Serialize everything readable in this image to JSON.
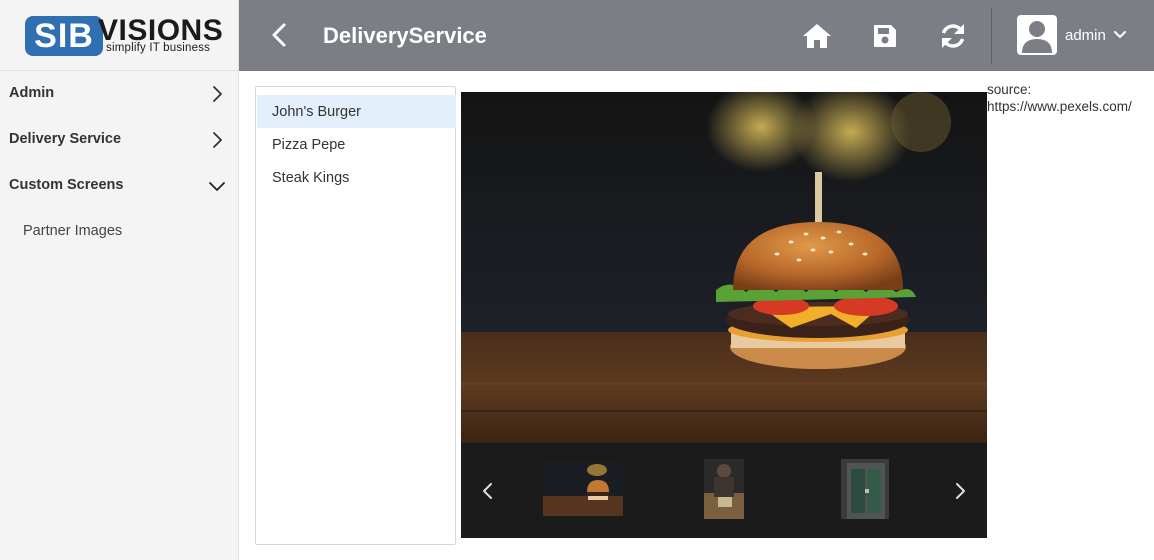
{
  "brand": {
    "logo_left": "SIB",
    "logo_right": "VISIONS",
    "tagline": "simplify IT business"
  },
  "header": {
    "title": "DeliveryService",
    "icons": [
      "back-icon",
      "home-icon",
      "save-icon",
      "refresh-icon",
      "chevron-down-icon"
    ],
    "user_name": "admin"
  },
  "sidebar": {
    "items": [
      {
        "label": "Admin",
        "expanded": false
      },
      {
        "label": "Delivery Service",
        "expanded": false
      },
      {
        "label": "Custom Screens",
        "expanded": true
      }
    ],
    "subitems": [
      {
        "label": "Partner Images"
      }
    ]
  },
  "partners": {
    "items": [
      "John's Burger",
      "Pizza Pepe",
      "Steak Kings"
    ],
    "selected": "John's Burger"
  },
  "gallery": {
    "main_image": "burger-photo",
    "thumbnails": [
      "burger-thumbnail",
      "kitchen-thumbnail",
      "restaurant-door-thumbnail"
    ],
    "prev_icon": "chevron-left-icon",
    "next_icon": "chevron-right-icon"
  },
  "source": {
    "label": "source:",
    "url": "https://www.pexels.com/"
  },
  "colors": {
    "header_bg": "#7b7f85",
    "sidebar_bg": "#f4f4f4",
    "selection_bg": "#e3f0fb",
    "brand_blue": "#2f6fb2"
  }
}
